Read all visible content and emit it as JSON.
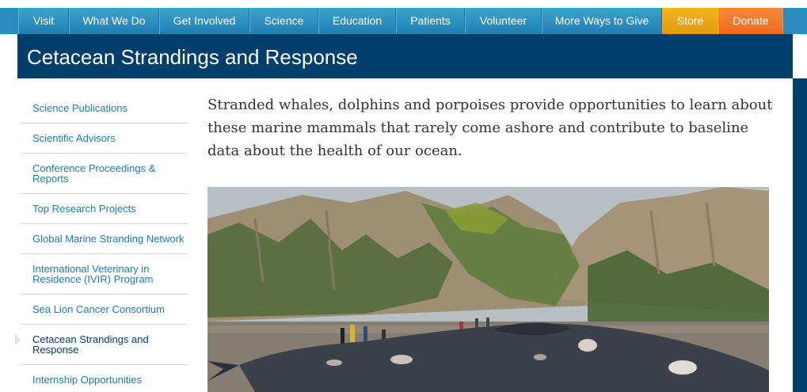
{
  "nav": {
    "items": [
      {
        "label": "Visit"
      },
      {
        "label": "What We Do"
      },
      {
        "label": "Get Involved"
      },
      {
        "label": "Science"
      },
      {
        "label": "Education"
      },
      {
        "label": "Patients"
      },
      {
        "label": "Volunteer"
      },
      {
        "label": "More Ways to Give"
      },
      {
        "label": "Store"
      },
      {
        "label": "Donate"
      }
    ]
  },
  "header": {
    "title": "Cetacean Strandings and Response"
  },
  "sidebar": {
    "items": [
      {
        "label": "Science Publications"
      },
      {
        "label": "Scientific Advisors"
      },
      {
        "label": "Conference Proceedings & Reports"
      },
      {
        "label": "Top Research Projects"
      },
      {
        "label": "Global Marine Stranding Network"
      },
      {
        "label": "International Veterinary in Residence (IVIR) Program"
      },
      {
        "label": "Sea Lion Cancer Consortium"
      },
      {
        "label": "Cetacean Strandings and Response"
      },
      {
        "label": "Internship Opportunities"
      }
    ]
  },
  "main": {
    "intro": "Stranded whales, dolphins and porpoises provide opportunities to learn about these marine mammals that rarely come ashore and contribute to baseline data about the health of our ocean."
  },
  "colors": {
    "nav_blue": "#2a8cc0",
    "header_navy": "#003f6b",
    "store_orange": "#f4b321",
    "donate_orange": "#f88a3a",
    "link_blue": "#1a7cb8"
  }
}
